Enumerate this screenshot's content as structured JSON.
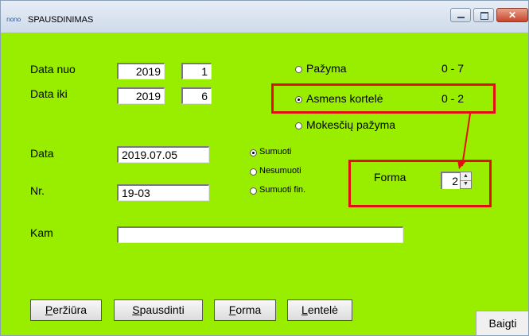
{
  "window": {
    "title": "SPAUSDINIMAS",
    "icon_text": "nono",
    "icon": "app-logo-icon",
    "accent": "#99ee00",
    "highlight_color": "#e01010",
    "controls": [
      "minimize-icon",
      "maximize-icon",
      "close-icon"
    ]
  },
  "form": {
    "data_nuo": {
      "label": "Data nuo",
      "year": "2019",
      "month": "1"
    },
    "data_iki": {
      "label": "Data iki",
      "year": "2019",
      "month": "6"
    },
    "data": {
      "label": "Data",
      "value": "2019.07.05"
    },
    "nr": {
      "label": "Nr.",
      "value": "19-03"
    },
    "kam": {
      "label": "Kam",
      "value": ""
    }
  },
  "doc_types": [
    {
      "label": "Pažyma",
      "range": "0 - 7",
      "checked": false
    },
    {
      "label": "Asmens kortelė",
      "range": "0 - 2",
      "checked": true
    },
    {
      "label": "Mokesčių pažyma",
      "range": "",
      "checked": false
    }
  ],
  "sum_options": [
    {
      "label": "Sumuoti",
      "checked": true
    },
    {
      "label": "Nesumuoti",
      "checked": false
    },
    {
      "label": "Sumuoti fin.",
      "checked": false
    }
  ],
  "forma": {
    "label": "Forma",
    "value": "2"
  },
  "buttons": {
    "perziura": {
      "first": "P",
      "rest": "eržiūra"
    },
    "spausdinti": {
      "first": "S",
      "rest": "pausdinti"
    },
    "forma": {
      "first": "F",
      "rest": "orma"
    },
    "lentele": {
      "first": "L",
      "rest": "entelė"
    },
    "baigti": "Baigti"
  }
}
